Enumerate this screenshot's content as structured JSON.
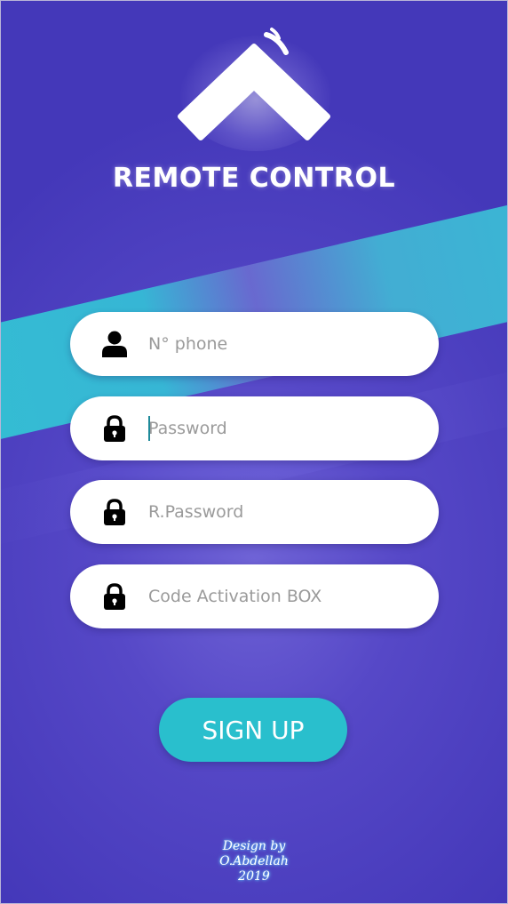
{
  "app": {
    "title": "REMOTE CONTROL",
    "logo_icon": "chevron-up-icon"
  },
  "form": {
    "fields": [
      {
        "name": "phone",
        "placeholder": "N° phone",
        "value": "",
        "icon": "user-icon"
      },
      {
        "name": "password",
        "placeholder": "Password",
        "value": "",
        "icon": "lock-icon",
        "focused": true
      },
      {
        "name": "repeat_password",
        "placeholder": "R.Password",
        "value": "",
        "icon": "lock-icon"
      },
      {
        "name": "activation_code",
        "placeholder": "Code Activation BOX",
        "value": "",
        "icon": "lock-icon"
      }
    ],
    "submit_label": "SIGN UP"
  },
  "credit": {
    "line1": "Design by",
    "line2": "O.Abdellah",
    "line3": "2019"
  },
  "colors": {
    "background": "#4a3fbf",
    "accent_stripe": "#36bfd6",
    "button": "#29bfcd",
    "field_bg": "#ffffff",
    "placeholder": "#9a9a9a",
    "caret": "#1e8a9a"
  }
}
